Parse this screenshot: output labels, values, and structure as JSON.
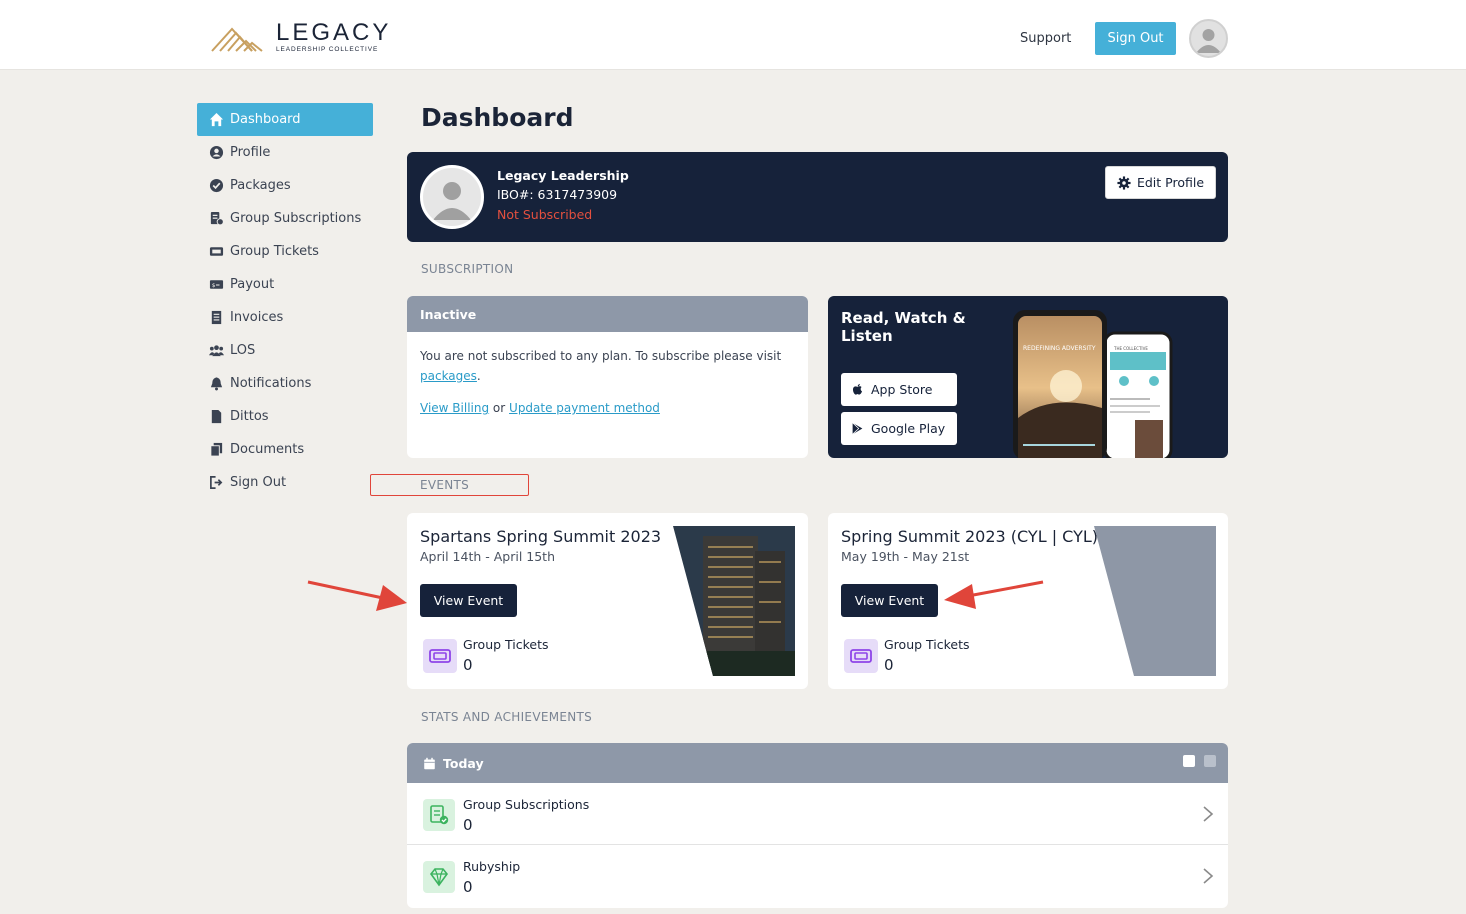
{
  "header": {
    "logo_main": "LEGACY",
    "logo_sub": "LEADERSHIP COLLECTIVE",
    "support_label": "Support",
    "signout_label": "Sign Out"
  },
  "sidebar": {
    "items": [
      {
        "label": "Dashboard",
        "icon": "home-icon",
        "active": true
      },
      {
        "label": "Profile",
        "icon": "user-circle-icon"
      },
      {
        "label": "Packages",
        "icon": "check-circle-icon"
      },
      {
        "label": "Group Subscriptions",
        "icon": "group-subscriptions-icon"
      },
      {
        "label": "Group Tickets",
        "icon": "ticket-icon"
      },
      {
        "label": "Payout",
        "icon": "money-icon"
      },
      {
        "label": "Invoices",
        "icon": "invoice-icon"
      },
      {
        "label": "LOS",
        "icon": "users-icon"
      },
      {
        "label": "Notifications",
        "icon": "bell-icon"
      },
      {
        "label": "Dittos",
        "icon": "file-icon"
      },
      {
        "label": "Documents",
        "icon": "documents-icon"
      },
      {
        "label": "Sign Out",
        "icon": "sign-out-icon"
      }
    ]
  },
  "main": {
    "title": "Dashboard",
    "profile": {
      "name": "Legacy Leadership",
      "ibo": "IBO#: 6317473909",
      "status": "Not Subscribed",
      "edit_label": "Edit Profile"
    },
    "subscription": {
      "section_label": "SUBSCRIPTION",
      "status": "Inactive",
      "message": "You are not subscribed to any plan. To subscribe please visit",
      "packages_link": "packages",
      "period": ".",
      "view_billing": "View Billing",
      "or": "or",
      "update_payment": "Update payment method"
    },
    "app_promo": {
      "title": "Read, Watch & Listen",
      "app_store": "App Store",
      "google_play": "Google Play",
      "phone_caption": "REDEFINING ADVERSITY",
      "phone2_caption": "THE COLLECTIVE"
    },
    "events": {
      "section_label": "EVENTS",
      "items": [
        {
          "title": "Spartans Spring Summit 2023",
          "date": "April 14th - April 15th",
          "button": "View Event",
          "tickets_label": "Group Tickets",
          "tickets_count": "0"
        },
        {
          "title": "Spring Summit 2023 (CYL | CYL)",
          "date": "May 19th - May 21st",
          "button": "View Event",
          "tickets_label": "Group Tickets",
          "tickets_count": "0"
        }
      ]
    },
    "stats": {
      "section_label": "STATS AND ACHIEVEMENTS",
      "period": "Today",
      "rows": [
        {
          "label": "Group Subscriptions",
          "count": "0"
        },
        {
          "label": "Rubyship",
          "count": "0"
        }
      ]
    }
  },
  "colors": {
    "accent": "#45b0d8",
    "navy": "#16223a",
    "alert": "#e4503f",
    "annotation": "#e0453a"
  }
}
